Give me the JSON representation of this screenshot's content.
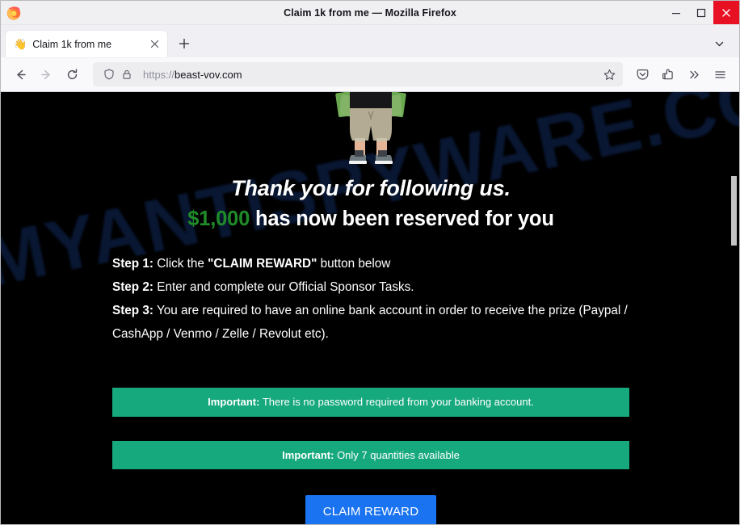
{
  "window": {
    "title": "Claim 1k from me — Mozilla Firefox",
    "minimize_label": "minimize",
    "maximize_label": "maximize",
    "close_label": "close"
  },
  "tabs": [
    {
      "favicon": "👋",
      "title": "Claim 1k from me",
      "close_label": "×"
    }
  ],
  "tabstrip": {
    "new_tab_label": "+",
    "list_all_tabs_label": "v"
  },
  "toolbar": {
    "back_label": "Back",
    "forward_label": "Forward",
    "reload_label": "Reload",
    "bookmark_label": "Bookmark this page",
    "pocket_label": "Save to Pocket",
    "extension_label": "Extensions",
    "overflow_label": "More tools",
    "menu_label": "Open application menu"
  },
  "urlbar": {
    "shield_label": "Tracking protection",
    "lock_label": "Connection secure",
    "scheme": "https://",
    "host": "beast-vov.com",
    "full_url": "https://beast-vov.com"
  },
  "page": {
    "watermark": "MYANTISPYWARE.COM",
    "hero_alt": "cartoon man holding cash",
    "headline": "Thank you for following us.",
    "amount": "$1,000",
    "subline_rest": " has now been reserved for you",
    "steps": [
      {
        "label": "Step 1:",
        "text_before": " Click the ",
        "quoted": "\"CLAIM REWARD\"",
        "text_after": " button below"
      },
      {
        "label": "Step 2:",
        "text_before": " Enter and complete our Official Sponsor Tasks.",
        "quoted": "",
        "text_after": ""
      },
      {
        "label": "Step 3:",
        "text_before": " You are required to have an online bank account in order to receive the prize (Paypal / CashApp / Venmo / Zelle / Revolut etc).",
        "quoted": "",
        "text_after": ""
      }
    ],
    "banners": [
      {
        "label": "Important:",
        "text": " There is no password required from your banking account."
      },
      {
        "label": "Important:",
        "text": " Only 7 quantities available"
      }
    ],
    "cta_label": "CLAIM REWARD"
  },
  "colors": {
    "banner_green": "#17a97e",
    "amount_green": "#1f8b28",
    "cta_blue": "#1a73f0",
    "page_background": "#000000",
    "watermark_blue": "#0d2046",
    "close_button_red": "#e81123"
  }
}
